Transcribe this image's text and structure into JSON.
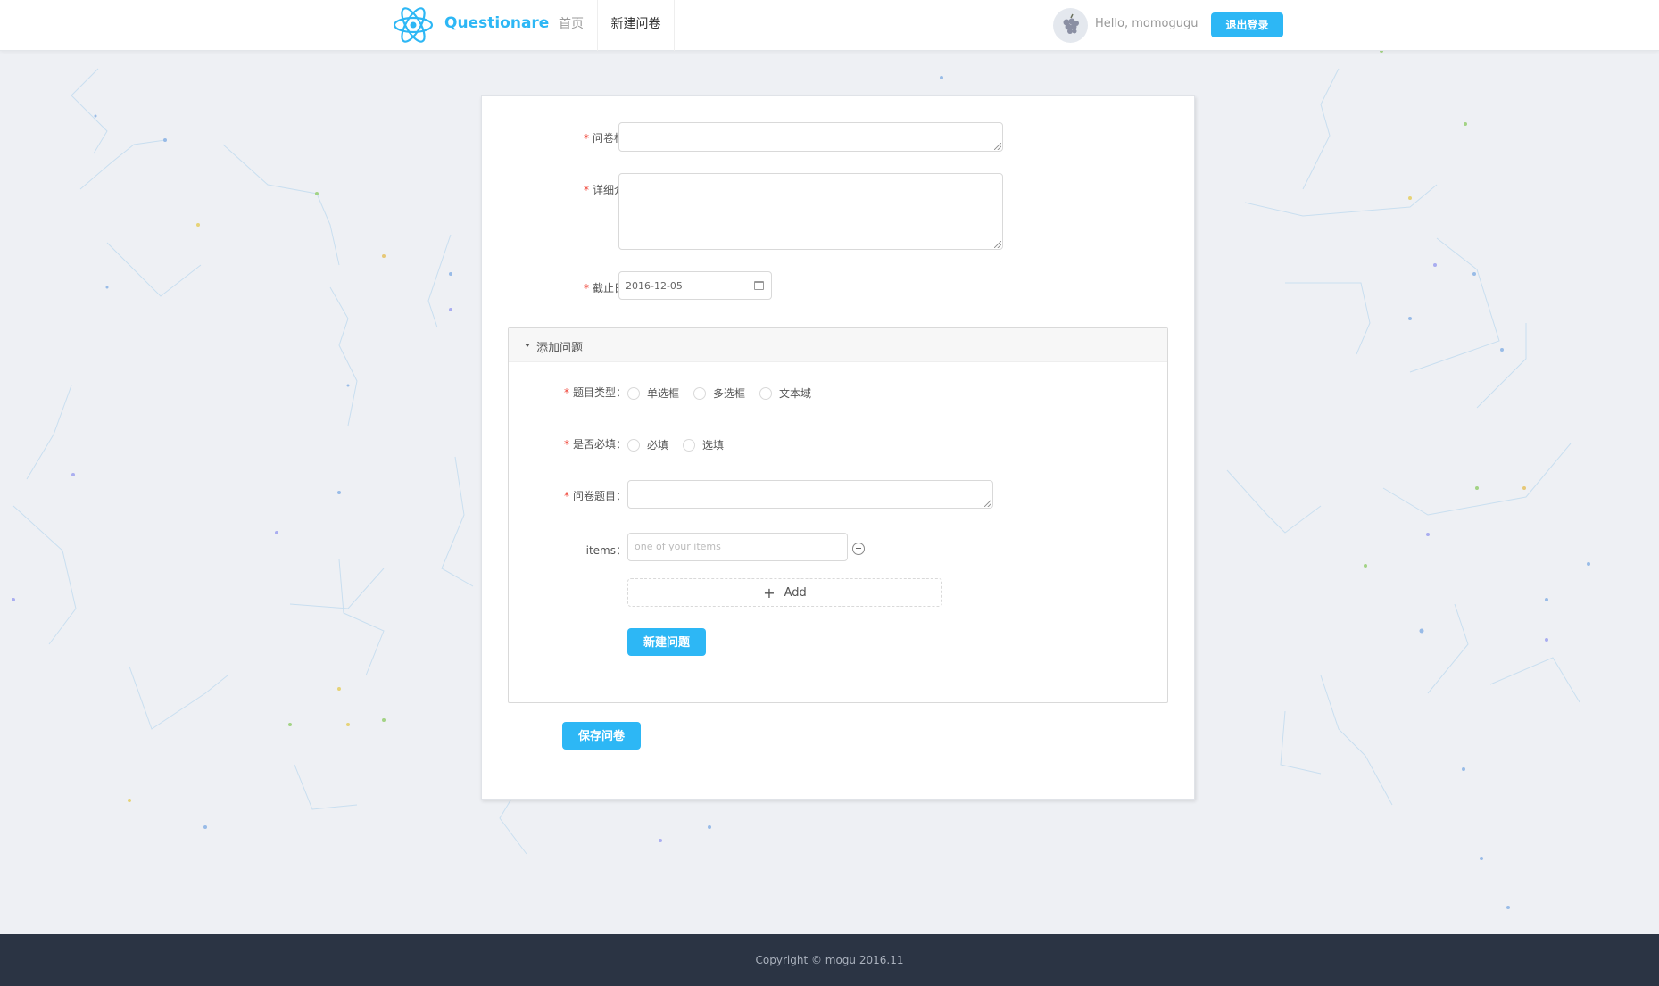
{
  "header": {
    "brand": "Questionare",
    "nav": {
      "home": "首页",
      "new_survey": "新建问卷"
    },
    "greeting": "Hello, momogugu",
    "logout": "退出登录"
  },
  "form": {
    "title_label": "问卷标题",
    "description_label": "详细介绍",
    "deadline_label": "截止日期",
    "deadline_value": "2016-12-05",
    "required_mark": "*"
  },
  "panel": {
    "title": "添加问题",
    "question_type_label": "题目类型",
    "question_type_options": [
      "单选框",
      "多选框",
      "文本域"
    ],
    "required_label": "是否必填",
    "required_options": [
      "必填",
      "选填"
    ],
    "question_label": "问卷题目",
    "items_label": "items",
    "items_placeholder": "one of your items",
    "add_label": "Add",
    "new_question_button": "新建问题"
  },
  "save_button": "保存问卷",
  "footer": {
    "copyright": "Copyright © mogu 2016.11"
  },
  "colors": {
    "primary": "#2db7f5",
    "required": "#f04134",
    "footer_bg": "#2b3444"
  }
}
